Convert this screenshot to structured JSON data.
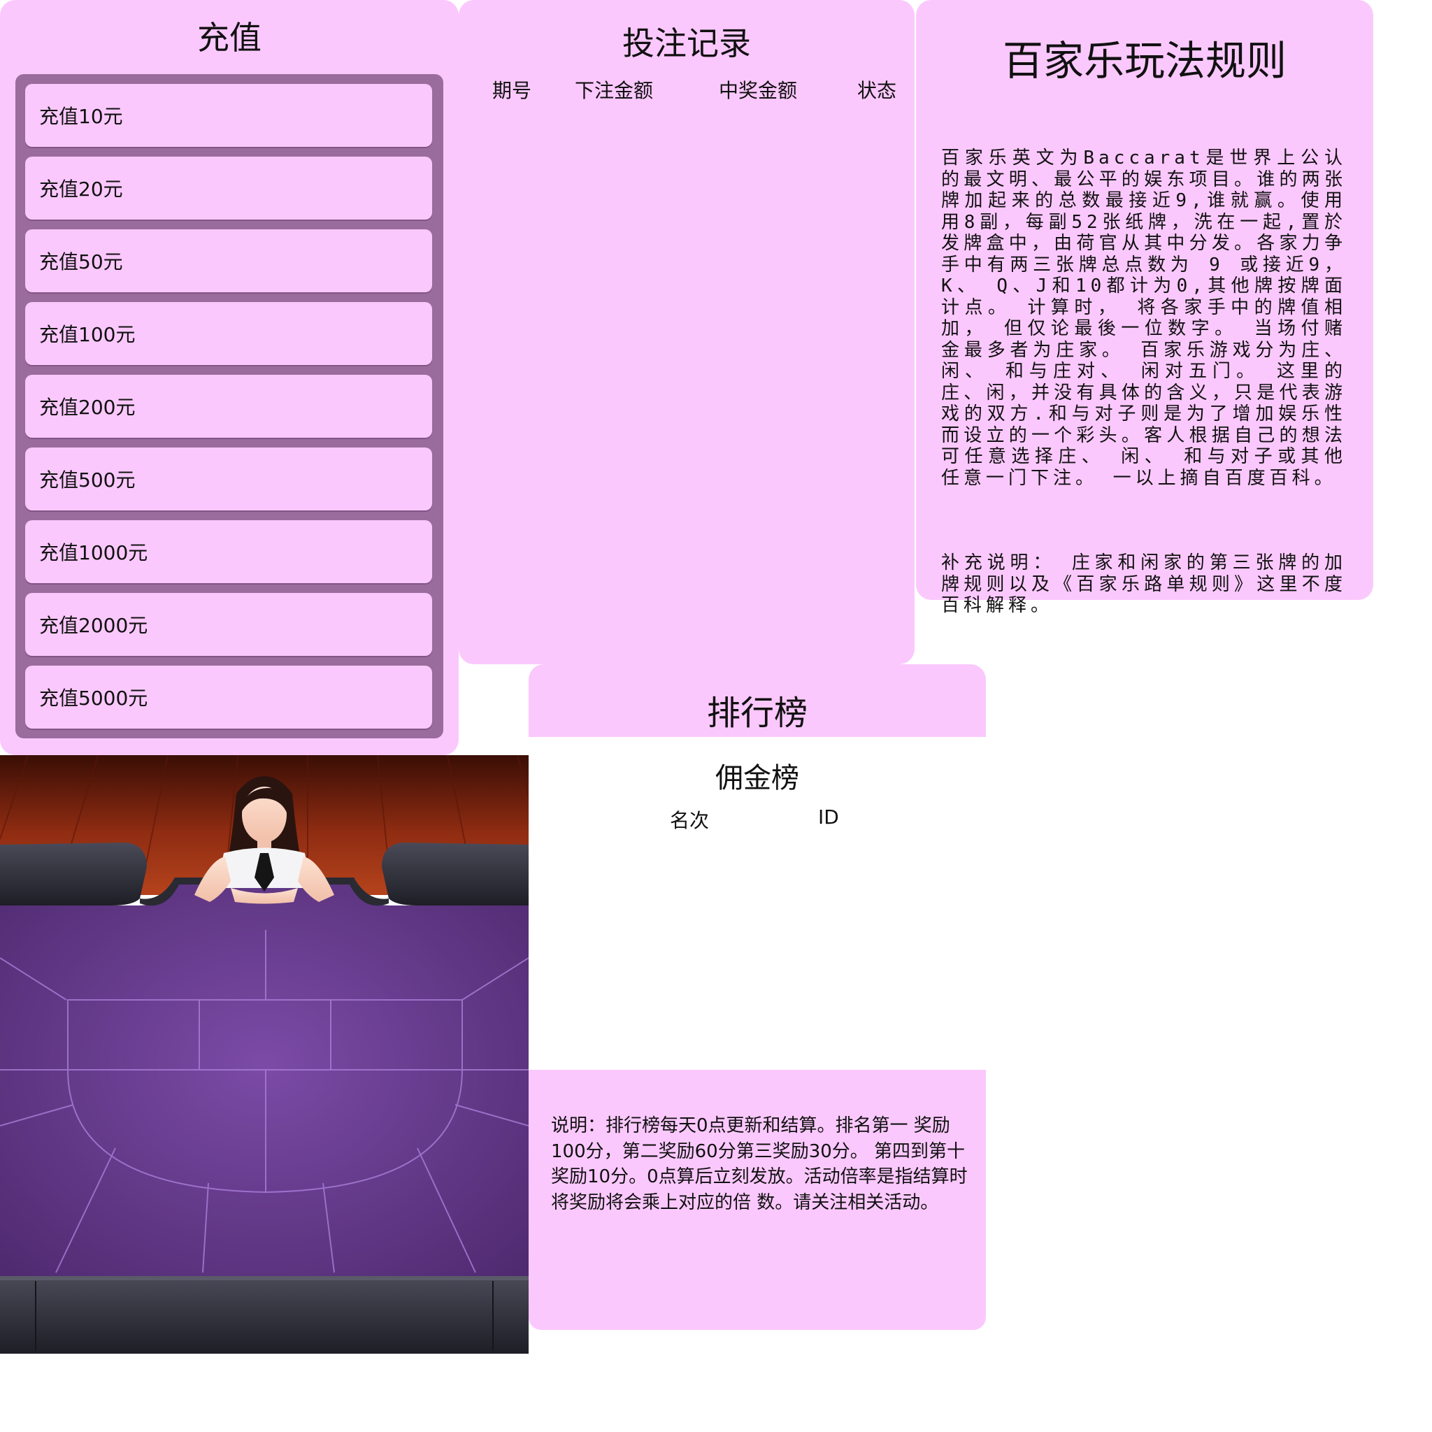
{
  "recharge": {
    "title": "充值",
    "options": [
      "充值10元",
      "充值20元",
      "充值50元",
      "充值100元",
      "充值200元",
      "充值500元",
      "充值1000元",
      "充值2000元",
      "充值5000元"
    ]
  },
  "bets": {
    "title": "投注记录",
    "columns": [
      "期号",
      "下注金额",
      "中奖金额",
      "状态"
    ]
  },
  "rules": {
    "title": "百家乐玩法规则",
    "body": "百家乐英文为Baccarat是世界上公认的最文明、最公平的娱东项目。谁的两张牌加起来的总数最接近9,谁就赢。使用用8副，每副52张纸牌，洗在一起,置於发牌盒中，由荷官从其中分发。各家力争手中有两三张牌总点数为 9 或接近9， K、 Q、J和10都计为0,其他牌按牌面计点。 计算时， 将各家手中的牌值相加， 但仅论最後一位数字。 当场付赌金最多者为庄家。 百家乐游戏分为庄、 闲、 和与庄对、 闲对五门。 这里的庄、闲，并没有具体的含义，只是代表游戏的双方.和与对子则是为了增加娱乐性而设立的一个彩头。客人根据自己的想法可任意选择庄、 闲、 和与对子或其他任意一门下注。 一以上摘自百度百科。",
    "supplement": "补充说明： 庄家和闲家的第三张牌的加牌规则以及《百家乐路单规则》这里不度百科解释。"
  },
  "leaderboard": {
    "title": "排行榜",
    "subtitle": "佣金榜",
    "columns": [
      "名次",
      "ID"
    ],
    "note": "说明：排行榜每天0点更新和结算。排名第一 奖励100分，第二奖励60分第三奖励30分。 第四到第十奖励10分。0点算后立刻发放。活动倍率是指结算时将奖励将会乘上对应的倍 数。请关注相关活动。"
  },
  "colors": {
    "panel_bg": "#fbc8fd",
    "recharge_frame": "#9a6b9d",
    "table_felt": "#6a3d90",
    "table_lines": "#a97ed8",
    "floor_wood": "#9a2f14",
    "table_rail": "#2f2f3a"
  },
  "icons": [
    "dealer-avatar",
    "baccarat-table"
  ]
}
